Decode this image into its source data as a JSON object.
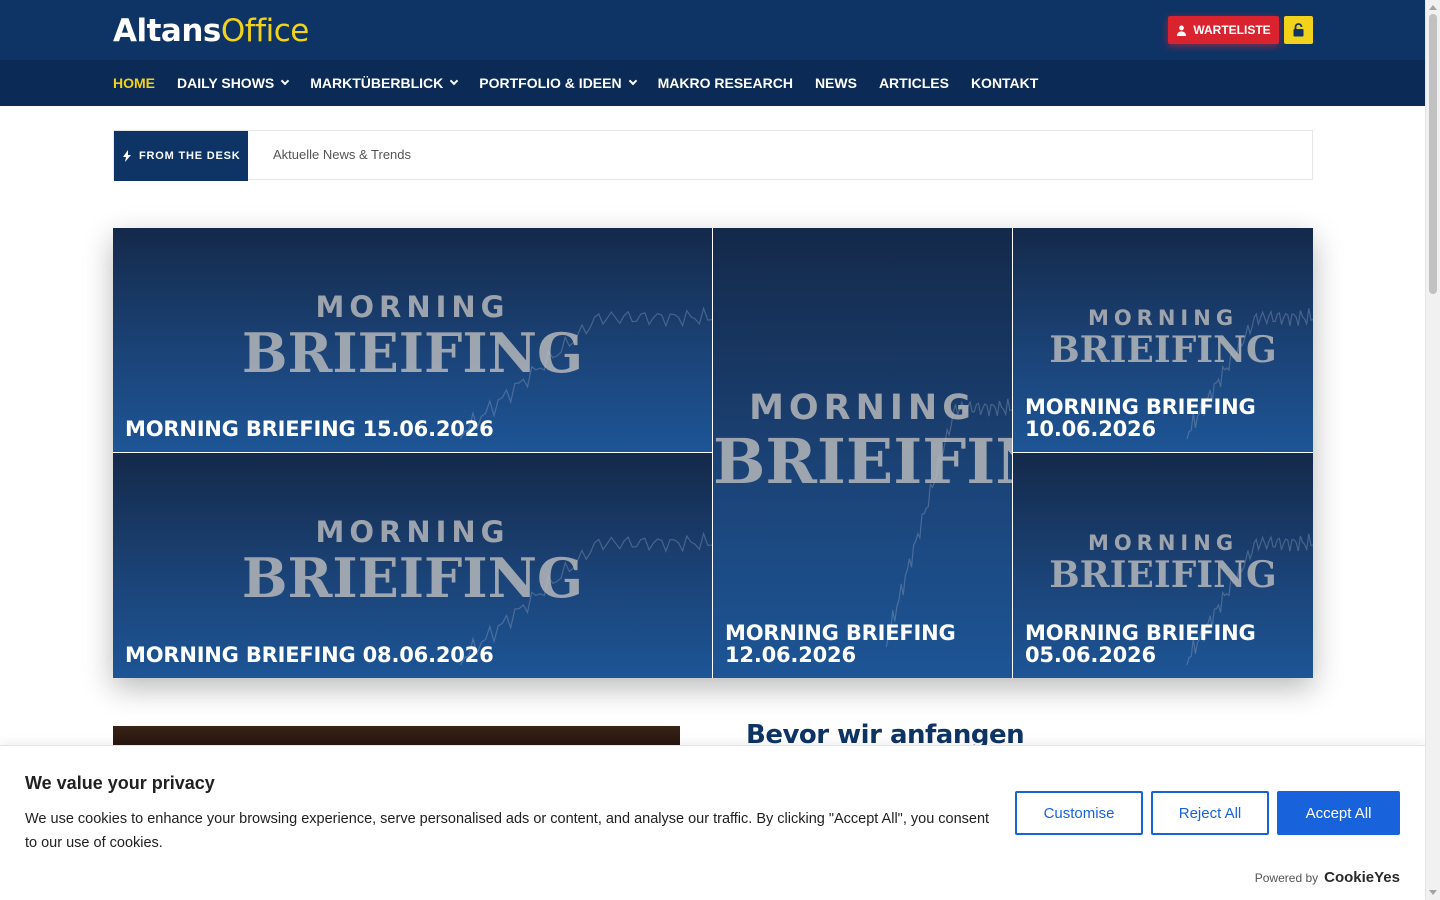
{
  "header": {
    "logo_bold": "Altans",
    "logo_light": "Office",
    "waitlist_label": "WARTELISTE"
  },
  "nav": {
    "items": [
      {
        "label": "HOME",
        "active": true,
        "dropdown": false
      },
      {
        "label": "DAILY SHOWS",
        "active": false,
        "dropdown": true
      },
      {
        "label": "MARKTÜBERBLICK",
        "active": false,
        "dropdown": true
      },
      {
        "label": "PORTFOLIO & IDEEN",
        "active": false,
        "dropdown": true
      },
      {
        "label": "MAKRO RESEARCH",
        "active": false,
        "dropdown": false
      },
      {
        "label": "NEWS",
        "active": false,
        "dropdown": false
      },
      {
        "label": "ARTICLES",
        "active": false,
        "dropdown": false
      },
      {
        "label": "KONTAKT",
        "active": false,
        "dropdown": false
      }
    ]
  },
  "ticker": {
    "label": "FROM THE DESK",
    "text": "Aktuelle News & Trends"
  },
  "tiles": {
    "watermark_line1": "MORNING",
    "watermark_line2": "BRIEIFING",
    "items": [
      {
        "title": "MORNING BRIEFING 15.06.2026"
      },
      {
        "title": "MORNING BRIEFING 12.06.2026"
      },
      {
        "title": "MORNING BRIEFING 10.06.2026"
      },
      {
        "title": "MORNING BRIEFING 08.06.2026"
      },
      {
        "title": "MORNING BRIEFING 05.06.2026"
      }
    ]
  },
  "section": {
    "heading": "Bevor wir anfangen"
  },
  "cookie": {
    "title": "We value your privacy",
    "text": "We use cookies to enhance your browsing experience, serve personalised ads or content, and analyse our traffic. By clicking \"Accept All\", you consent to our use of cookies.",
    "customise_label": "Customise",
    "reject_label": "Reject All",
    "accept_label": "Accept All",
    "powered_by": "Powered by",
    "brand": "CookieYes"
  },
  "colors": {
    "brand_navy": "#0e3466",
    "brand_yellow": "#f2d21b",
    "waitlist_red": "#d9232e",
    "cookie_blue": "#1863dc"
  }
}
